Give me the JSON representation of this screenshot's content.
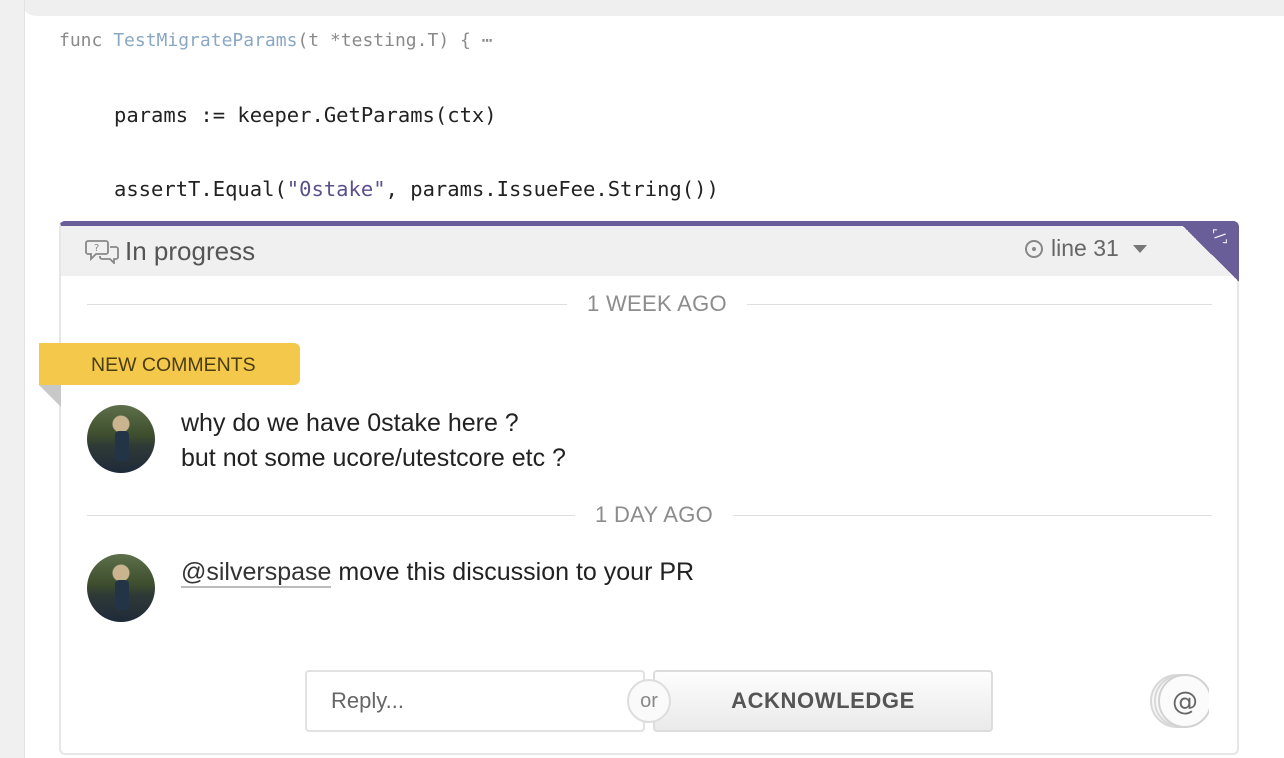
{
  "code": {
    "signature_keyword": "func",
    "signature_name": "TestMigrateParams",
    "signature_rest": "(t *testing.T) { ⋯",
    "line1": "params := keeper.GetParams(ctx)",
    "line2_prefix": "assertT.Equal(",
    "line2_string": "\"0stake\"",
    "line2_suffix": ", params.IssueFee.String())"
  },
  "discussion": {
    "status": "In progress",
    "line_ref": "line 31",
    "corner_glyph": "‹/›",
    "divider1": "1 WEEK AGO",
    "new_comments_label": "NEW COMMENTS",
    "comment1_line1": "why do we have 0stake here ?",
    "comment1_line2": "but not some ucore/utestcore etc ?",
    "divider2": "1 DAY AGO",
    "comment2_mention": "@silverspase",
    "comment2_text": " move this discussion to your PR",
    "reply_placeholder": "Reply...",
    "or_label": "or",
    "acknowledge_label": "ACKNOWLEDGE"
  },
  "colors": {
    "accent": "#6a5e98",
    "ribbon": "#f4c84a",
    "header_bg": "#f0f0f0"
  },
  "icons": {
    "status": "discussion-bubbles-icon",
    "line_ref": "target-icon",
    "dropdown": "caret-down-icon",
    "mention": "at-mention-icon"
  }
}
